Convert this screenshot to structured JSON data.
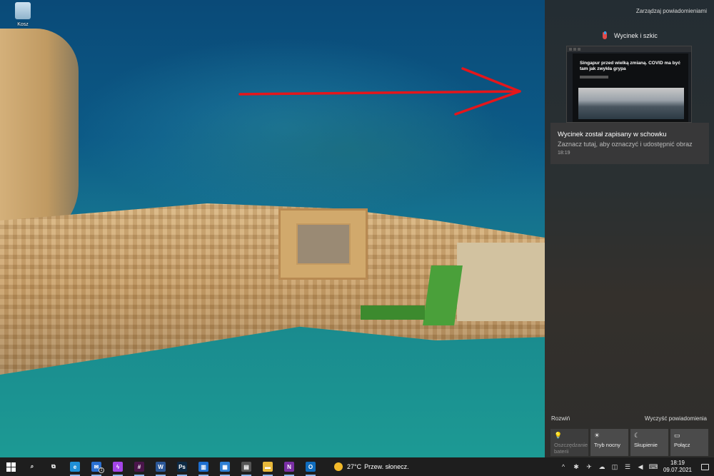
{
  "desktop": {
    "recycle_bin_label": "Kosz"
  },
  "action_center": {
    "manage_label": "Zarządzaj powiadomieniami",
    "notification": {
      "app_name": "Wycinek i szkic",
      "app_icon": "snip-sketch-icon",
      "thumbnail_headline": "Singapur przed wielką zmianą. COVID ma być tam jak zwykła grypa",
      "title": "Wycinek został zapisany w schowku",
      "body": "Zaznacz tutaj, aby oznaczyć i udostępnić obraz",
      "time": "18:19"
    },
    "expand_label": "Rozwiń",
    "clear_label": "Wyczyść powiadomienia",
    "quick_actions": [
      {
        "label": "Oszczędzanie baterii",
        "icon": "💡",
        "disabled": true
      },
      {
        "label": "Tryb nocny",
        "icon": "☀",
        "disabled": false
      },
      {
        "label": "Skupienie",
        "icon": "☾",
        "disabled": false
      },
      {
        "label": "Połącz",
        "icon": "▭",
        "disabled": false
      }
    ]
  },
  "taskbar": {
    "apps": [
      {
        "name": "search-button",
        "glyph": "⌕",
        "color": "transparent"
      },
      {
        "name": "task-view-button",
        "glyph": "⧉",
        "color": "transparent"
      },
      {
        "name": "edge-app",
        "glyph": "e",
        "color": "#1f8fd6"
      },
      {
        "name": "mail-app",
        "glyph": "✉",
        "color": "#2a6fd0",
        "badge": "1"
      },
      {
        "name": "messenger-app",
        "glyph": "ϟ",
        "color": "#a445e8"
      },
      {
        "name": "slack-app",
        "glyph": "#",
        "color": "#4a154b"
      },
      {
        "name": "word-app",
        "glyph": "W",
        "color": "#2b5797"
      },
      {
        "name": "photoshop-app",
        "glyph": "Ps",
        "color": "#0d2a44"
      },
      {
        "name": "trello-app",
        "glyph": "▥",
        "color": "#1e6fd0"
      },
      {
        "name": "photos-app",
        "glyph": "▦",
        "color": "#2d7fd3"
      },
      {
        "name": "calculator-app",
        "glyph": "▤",
        "color": "#555"
      },
      {
        "name": "file-explorer-app",
        "glyph": "▬",
        "color": "#e8b83a"
      },
      {
        "name": "onenote-app",
        "glyph": "N",
        "color": "#7a2fa4"
      },
      {
        "name": "outlook-app",
        "glyph": "O",
        "color": "#0f6cbd"
      }
    ],
    "weather": {
      "temp": "27°C",
      "desc": "Przew. słonecz."
    },
    "tray_icons": [
      "^",
      "✱",
      "✈",
      "☁",
      "◫",
      "☰",
      "◀",
      "⌨"
    ],
    "clock": {
      "time": "18:19",
      "date": "09.07.2021"
    }
  }
}
